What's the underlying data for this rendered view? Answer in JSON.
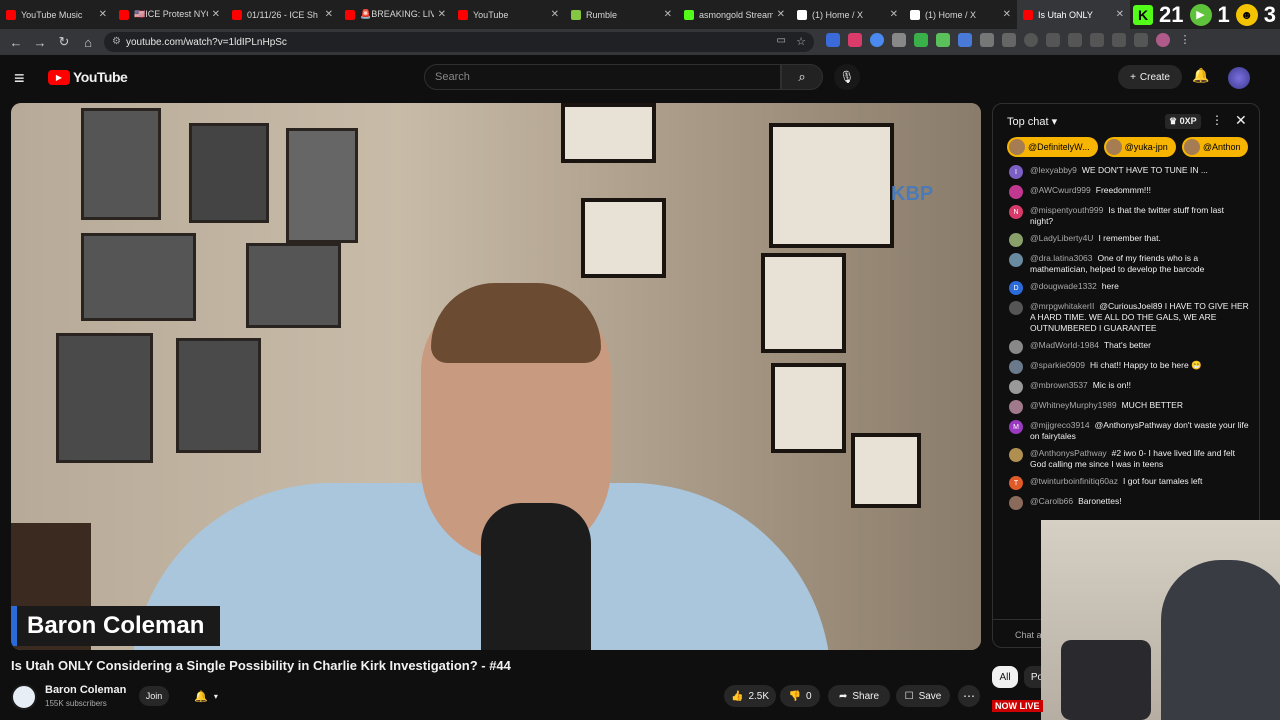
{
  "browser": {
    "tabs": [
      {
        "label": "YouTube Music",
        "color": "#ff0000"
      },
      {
        "label": "🇺🇸ICE Protest NYC",
        "color": "#ff0000"
      },
      {
        "label": "01/11/26 - ICE Sh",
        "color": "#ff0000"
      },
      {
        "label": "🚨BREAKING: LIV",
        "color": "#ff0000"
      },
      {
        "label": "YouTube",
        "color": "#ff0000"
      },
      {
        "label": "Rumble",
        "color": "#85c742"
      },
      {
        "label": "asmongold Stream",
        "color": "#53fc18"
      },
      {
        "label": "(1) Home / X",
        "color": "#ffffff"
      },
      {
        "label": "(1) Home / X",
        "color": "#ffffff"
      },
      {
        "label": "Is Utah ONLY",
        "color": "#ff0000",
        "active": true
      }
    ],
    "overlay": {
      "k_label": "K",
      "num1": "21",
      "num2": "1",
      "num3": "3"
    },
    "url": "youtube.com/watch?v=1ldIPLnHpSc"
  },
  "youtube": {
    "logo_text": "YouTube",
    "search_placeholder": "Search",
    "create_label": "Create"
  },
  "video": {
    "lower_third_name": "Baron Coleman",
    "title": "Is Utah ONLY Considering a Single Possibility in Charlie Kirk Investigation? - #44",
    "channel_name": "Baron Coleman",
    "subscribers": "155K subscribers",
    "join_label": "Join",
    "likes": "2.5K",
    "dislikes": "0",
    "share_label": "Share",
    "save_label": "Save"
  },
  "chat": {
    "header": "Top chat",
    "xp": "0XP",
    "tickers": [
      "@DefinitelyW...",
      "@yuka-jpn",
      "@Anthon"
    ],
    "messages": [
      {
        "name": "@lexyabby9",
        "text": "WE DON'T HAVE TO TUNE IN ...",
        "avatar": "I",
        "color": "#7b5fc4"
      },
      {
        "name": "@AWCwurd999",
        "text": "Freedommm!!!",
        "avatar": "",
        "color": "#c0388f"
      },
      {
        "name": "@mispentyouth999",
        "text": "Is that the twitter stuff from last night?",
        "avatar": "N",
        "color": "#d93a6a"
      },
      {
        "name": "@LadyLiberty4U",
        "text": "I remember that.",
        "avatar": "",
        "color": "#8aa06a"
      },
      {
        "name": "@dra.latina3063",
        "text": "One of my friends who is a mathematician, helped to develop the barcode",
        "avatar": "",
        "color": "#6a8aa0"
      },
      {
        "name": "@dougwade1332",
        "text": "here",
        "avatar": "D",
        "color": "#2a6ad9"
      },
      {
        "name": "@mrpgwhitakerII",
        "text": "@CuriousJoel89 I HAVE TO GIVE HER A HARD TIME. WE ALL DO THE GALS, WE ARE OUTNUMBERED I GUARANTEE",
        "avatar": "",
        "color": "#555"
      },
      {
        "name": "@MadWorld-1984",
        "text": "That's better",
        "avatar": "",
        "color": "#888"
      },
      {
        "name": "@sparkie0909",
        "text": "Hi chat!! Happy to be here 😁",
        "avatar": "",
        "color": "#6a7a8a"
      },
      {
        "name": "@mbrown3537",
        "text": "Mic is on!!",
        "avatar": "",
        "color": "#999"
      },
      {
        "name": "@WhitneyMurphy1989",
        "text": "MUCH BETTER",
        "avatar": "",
        "color": "#a07a8a"
      },
      {
        "name": "@mjjgreco3914",
        "text": "@AnthonysPathway don't waste your life on fairytales",
        "avatar": "M",
        "color": "#9a3ac0"
      },
      {
        "name": "@AnthonysPathway",
        "text": "#2 iwo 0- I have lived life and felt God calling me since I was in teens",
        "avatar": "",
        "color": "#b09050"
      },
      {
        "name": "@twinturboinfinitiq60az",
        "text": "I got four tamales left",
        "avatar": "T",
        "color": "#e05a2a"
      },
      {
        "name": "@Carolb66",
        "text": "Baronettes!",
        "avatar": "",
        "color": "#8a6a5a"
      }
    ],
    "input_placeholder": "Chat a..."
  },
  "filters": {
    "all": "All",
    "next": "Po"
  },
  "now_live": "NOW LIVE"
}
